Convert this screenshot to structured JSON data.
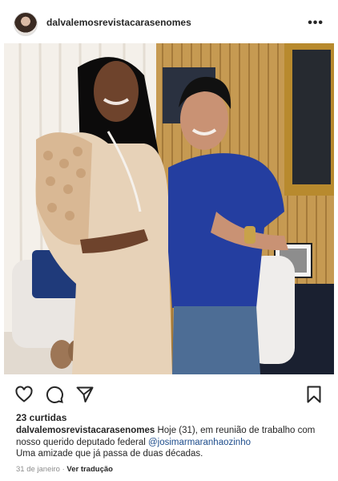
{
  "post": {
    "username": "dalvalemosrevistacarasenomes",
    "more_icon": "more-horizontal-icon",
    "more_glyph": "•••"
  },
  "actions": {
    "like_icon": "heart-icon",
    "comment_icon": "comment-icon",
    "share_icon": "send-icon",
    "save_icon": "bookmark-icon"
  },
  "likes": "23 curtidas",
  "caption": {
    "username": "dalvalemosrevistacarasenomes",
    "text_part1": "Hoje (31), em reunião  de trabalho com nosso querido  deputado federal ",
    "mention": "@josimarmaranhaozinho",
    "text_part2": "Uma amizade  que já passa de duas  décadas."
  },
  "meta": {
    "date": "31 de janeiro",
    "separator": " · ",
    "translate": "Ver tradução"
  }
}
